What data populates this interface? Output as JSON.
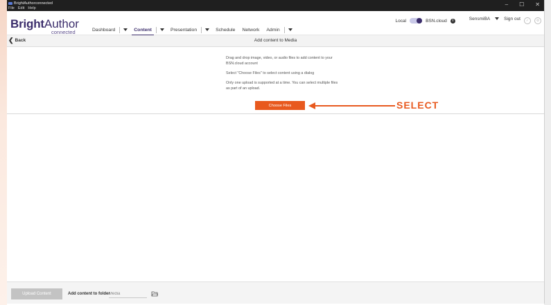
{
  "titlebar": {
    "title": "BrightAuthorconnected",
    "menu": [
      "File",
      "Edit",
      "Help"
    ],
    "controls": [
      "–",
      "☐",
      "✕"
    ]
  },
  "header": {
    "logo_bright": "Bright",
    "logo_author": "Author",
    "logo_connected": "connected",
    "nav": [
      {
        "label": "Dashboard",
        "active": false
      },
      {
        "label": "Content",
        "active": true
      },
      {
        "label": "Presentation",
        "active": false
      },
      {
        "label": "Schedule",
        "active": false
      },
      {
        "label": "Network",
        "active": false
      },
      {
        "label": "Admin",
        "active": false
      }
    ],
    "local_label": "Local",
    "cloud_label": "BSN.cloud",
    "user": "SensmiBA",
    "sign_out": "Sign out"
  },
  "subbar": {
    "back_label": "Back",
    "title": "Add content to Media"
  },
  "drop_area": {
    "instruction_1": "Drag and drop image, video, or audio files to add content to your BSN.cloud account",
    "instruction_2": "Select \"Choose Files\" to select content using a dialog",
    "instruction_3": "Only one upload is supported at a time. You can select multiple files as part of an upload.",
    "choose_files": "Choose Files",
    "annotation": "SELECT"
  },
  "footer": {
    "upload_button": "Upload Content",
    "folder_label": "Add content to folder",
    "folder_value": "Media"
  },
  "colors": {
    "accent_orange": "#e8591e",
    "brand_purple": "#3b2d6b",
    "titlebar": "#1f1f1f"
  }
}
